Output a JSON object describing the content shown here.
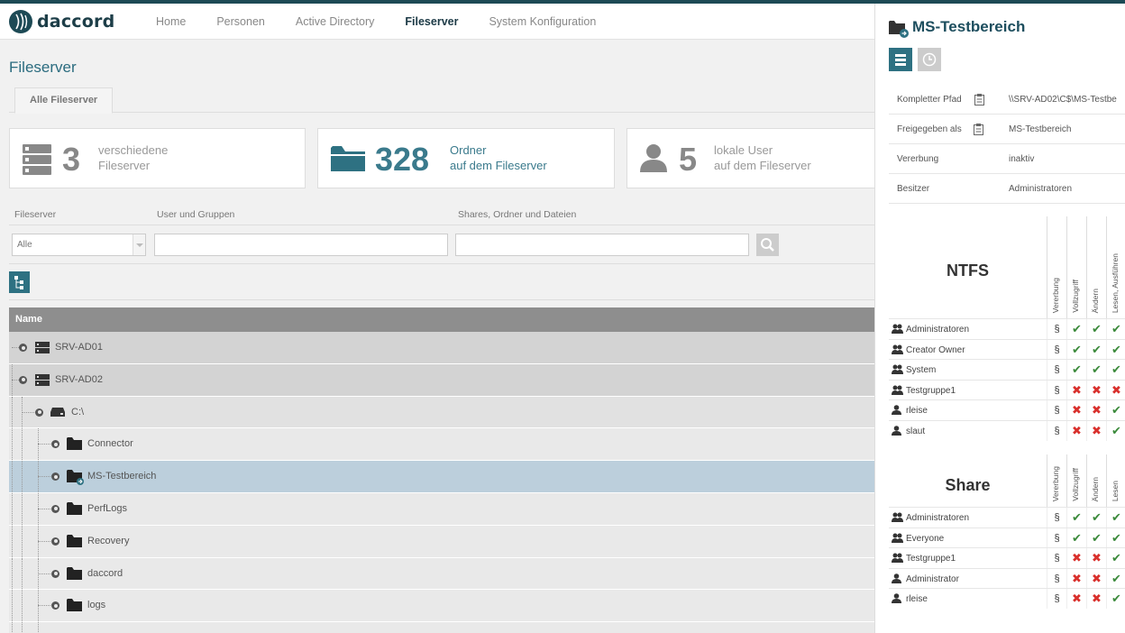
{
  "app": {
    "logo_text": "daccord"
  },
  "nav": [
    {
      "label": "Home",
      "active": false
    },
    {
      "label": "Personen",
      "active": false
    },
    {
      "label": "Active Directory",
      "active": false
    },
    {
      "label": "Fileserver",
      "active": true
    },
    {
      "label": "System Konfiguration",
      "active": false
    }
  ],
  "page": {
    "title": "Fileserver",
    "tab": "Alle Fileserver"
  },
  "stats": [
    {
      "icon": "server-stack-icon",
      "number": "3",
      "line1": "verschiedene",
      "line2": "Fileserver"
    },
    {
      "icon": "folder-icon",
      "number": "328",
      "line1": "Ordner",
      "line2": "auf dem Fileserver"
    },
    {
      "icon": "user-icon",
      "number": "5",
      "line1": "lokale User",
      "line2": "auf dem Fileserver"
    }
  ],
  "filters": {
    "fileserver_label": "Fileserver",
    "fileserver_value": "Alle",
    "users_label": "User und Gruppen",
    "users_value": "",
    "shares_label": "Shares, Ordner und Dateien",
    "shares_value": ""
  },
  "table": {
    "header": "Name",
    "rows": [
      {
        "label": "SRV-AD01",
        "level": 0,
        "icon": "server-icon",
        "selected": false
      },
      {
        "label": "SRV-AD02",
        "level": 0,
        "icon": "server-icon",
        "selected": false
      },
      {
        "label": "C:\\",
        "level": 1,
        "icon": "drive-icon",
        "selected": false
      },
      {
        "label": "Connector",
        "level": 2,
        "icon": "folder-icon",
        "selected": false
      },
      {
        "label": "MS-Testbereich",
        "level": 2,
        "icon": "shared-folder-icon",
        "selected": true
      },
      {
        "label": "PerfLogs",
        "level": 2,
        "icon": "folder-icon",
        "selected": false
      },
      {
        "label": "Recovery",
        "level": 2,
        "icon": "folder-icon",
        "selected": false
      },
      {
        "label": "daccord",
        "level": 2,
        "icon": "folder-icon",
        "selected": false
      },
      {
        "label": "logs",
        "level": 2,
        "icon": "folder-icon",
        "selected": false
      }
    ]
  },
  "detail": {
    "title": "MS-Testbereich",
    "properties": [
      {
        "key": "Kompletter Pfad",
        "value": "\\\\SRV-AD02\\C$\\MS-Testbe",
        "copy": true
      },
      {
        "key": "Freigegeben als",
        "value": "MS-Testbereich",
        "copy": true
      },
      {
        "key": "Vererbung",
        "value": "inaktiv",
        "copy": false
      },
      {
        "key": "Besitzer",
        "value": "Administratoren",
        "copy": false
      }
    ],
    "ntfs": {
      "title": "NTFS",
      "columns": [
        "Vererbung",
        "Vollzugriff",
        "Ändern",
        "Lesen, Ausführen"
      ],
      "rows": [
        {
          "name": "Administratoren",
          "type": "group",
          "inherit": "§",
          "perms": [
            "ok",
            "ok",
            "ok"
          ]
        },
        {
          "name": "Creator Owner",
          "type": "group",
          "inherit": "§",
          "perms": [
            "ok",
            "ok",
            "ok"
          ]
        },
        {
          "name": "System",
          "type": "group",
          "inherit": "§",
          "perms": [
            "ok",
            "ok",
            "ok"
          ]
        },
        {
          "name": "Testgruppe1",
          "type": "group",
          "inherit": "§",
          "perms": [
            "no",
            "no",
            "no"
          ]
        },
        {
          "name": "rleise",
          "type": "user",
          "inherit": "§",
          "perms": [
            "no",
            "no",
            "ok"
          ]
        },
        {
          "name": "slaut",
          "type": "user",
          "inherit": "§",
          "perms": [
            "no",
            "no",
            "ok"
          ]
        }
      ]
    },
    "share": {
      "title": "Share",
      "columns": [
        "Vererbung",
        "Vollzugriff",
        "Ändern",
        "Lesen"
      ],
      "rows": [
        {
          "name": "Administratoren",
          "type": "group",
          "inherit": "§",
          "perms": [
            "ok",
            "ok",
            "ok"
          ]
        },
        {
          "name": "Everyone",
          "type": "group",
          "inherit": "§",
          "perms": [
            "ok",
            "ok",
            "ok"
          ]
        },
        {
          "name": "Testgruppe1",
          "type": "group",
          "inherit": "§",
          "perms": [
            "no",
            "no",
            "ok"
          ]
        },
        {
          "name": "Administrator",
          "type": "user",
          "inherit": "§",
          "perms": [
            "no",
            "no",
            "ok"
          ]
        },
        {
          "name": "rleise",
          "type": "user",
          "inherit": "§",
          "perms": [
            "no",
            "no",
            "ok"
          ]
        }
      ]
    }
  },
  "colors": {
    "accent": "#2e7182",
    "title": "#2b6c7f",
    "selected_row": "#bccfdc",
    "ok": "#3b8a3b",
    "no": "#d9302c"
  }
}
